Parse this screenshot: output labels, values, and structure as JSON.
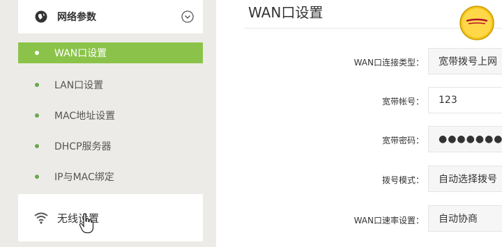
{
  "sidebar": {
    "top_item": {
      "label": "网络参数",
      "icon": "globe-icon",
      "chevron": "chevron-down-icon"
    },
    "sub_items": [
      {
        "label": "WAN口设置",
        "active": true
      },
      {
        "label": "LAN口设置",
        "active": false
      },
      {
        "label": "MAC地址设置",
        "active": false
      },
      {
        "label": "DHCP服务器",
        "active": false
      },
      {
        "label": "IP与MAC绑定",
        "active": false
      }
    ],
    "bottom_item": {
      "label": "无线设置",
      "icon": "wifi-icon"
    }
  },
  "main": {
    "title": "WAN口设置",
    "fields": [
      {
        "label": "WAN口连接类型：",
        "value": "宽带拨号上网"
      },
      {
        "label": "宽带帐号：",
        "value": "123"
      },
      {
        "label": "宽带密码：",
        "value": "●●●●●●●●●●"
      },
      {
        "label": "拨号模式：",
        "value": "自动选择拨号"
      },
      {
        "label": "WAN口速率设置：",
        "value": "自动协商"
      }
    ]
  },
  "colors": {
    "accent_green": "#8bc34a",
    "dot_green": "#6aa84f",
    "sidebar_bg": "#edebe7"
  }
}
